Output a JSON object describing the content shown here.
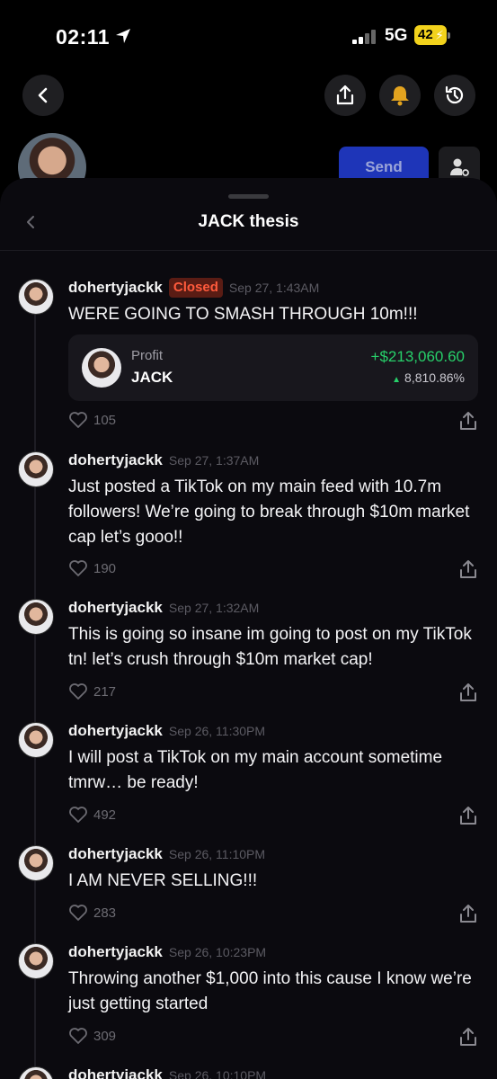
{
  "status_bar": {
    "time": "02:11",
    "network": "5G",
    "battery": "42"
  },
  "header": {
    "send_label": "Send"
  },
  "sheet": {
    "title": "JACK thesis",
    "card": {
      "label": "Profit",
      "ticker": "JACK",
      "value": "+$213,060.60",
      "percent": "8,810.86%"
    },
    "posts": [
      {
        "username": "dohertyjackk",
        "badge": "Closed",
        "timestamp": "Sep 27, 1:43AM",
        "text": "WERE GOING TO SMASH THROUGH 10m!!!",
        "likes": "105"
      },
      {
        "username": "dohertyjackk",
        "timestamp": "Sep 27, 1:37AM",
        "text": "Just posted a TikTok on my main feed with 10.7m followers! We’re going to break through $10m market cap let’s gooo!!",
        "likes": "190"
      },
      {
        "username": "dohertyjackk",
        "timestamp": "Sep 27, 1:32AM",
        "text": "This is going so insane im going to post on my TikTok tn! let’s crush through $10m market cap!",
        "likes": "217"
      },
      {
        "username": "dohertyjackk",
        "timestamp": "Sep 26, 11:30PM",
        "text": "I will post a TikTok on my main account sometime tmrw… be ready!",
        "likes": "492"
      },
      {
        "username": "dohertyjackk",
        "timestamp": "Sep 26, 11:10PM",
        "text": "I AM NEVER SELLING!!!",
        "likes": "283"
      },
      {
        "username": "dohertyjackk",
        "timestamp": "Sep 26, 10:23PM",
        "text": "Throwing another $1,000 into this cause I know we’re just getting started",
        "likes": "309"
      },
      {
        "username": "dohertyjackk",
        "timestamp": "Sep 26, 10:10PM"
      }
    ]
  },
  "colors": {
    "background": "#000000",
    "sheet": "#0b0a0f",
    "accent_blue": "#1e35b8",
    "profit_green": "#27d06a",
    "closed_red": "#ff5a3c",
    "bell_gold": "#e2a31f"
  },
  "icons": [
    "location-arrow-icon",
    "back-chevron-icon",
    "share-icon",
    "bell-icon",
    "history-icon",
    "person-settings-icon",
    "heart-icon"
  ]
}
